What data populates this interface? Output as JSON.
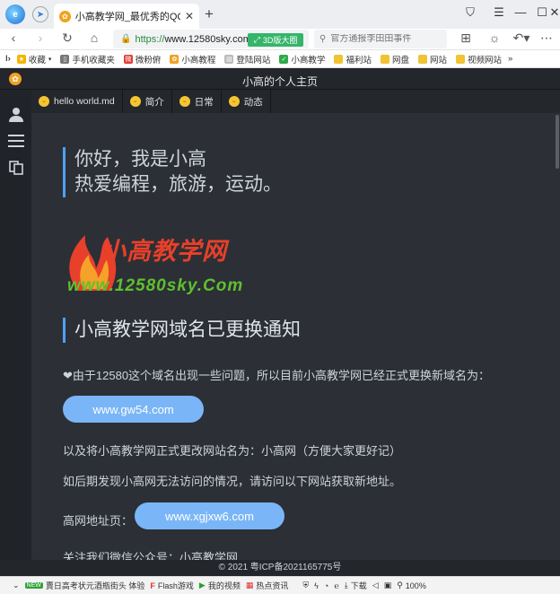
{
  "browser": {
    "tab_title": "小高教学网_最优秀的QQ技术网",
    "url_scheme": "https://",
    "url_host": "www.12580sky.com",
    "tag_label": "3D版大圈",
    "search_placeholder": "官方通报李田田事件",
    "bookmarks": [
      {
        "label": "收藏",
        "icon": "star-icon"
      },
      {
        "label": "手机收藏夹",
        "icon": "phone-icon"
      },
      {
        "label": "微粉俯",
        "icon": "weibo-icon"
      },
      {
        "label": "小高教程",
        "icon": "site-icon"
      },
      {
        "label": "登陆网站",
        "icon": "page-icon"
      },
      {
        "label": "小高教学",
        "icon": "check-icon"
      },
      {
        "label": "福利站",
        "icon": "folder-icon"
      },
      {
        "label": "网盘",
        "icon": "folder-icon"
      },
      {
        "label": "网站",
        "icon": "folder-icon"
      },
      {
        "label": "视频网站",
        "icon": "folder-icon"
      }
    ],
    "bookmarks_more": "»"
  },
  "site": {
    "title": "小高的个人主页",
    "tabs": [
      {
        "label": "hello world.md"
      },
      {
        "label": "简介"
      },
      {
        "label": "日常"
      },
      {
        "label": "动态"
      }
    ]
  },
  "content": {
    "hero_line1": "你好，我是小高",
    "hero_line2": "热爱编程，旅游，运动。",
    "logo_text": "小高教学网",
    "logo_url": "www.12580sky.Com",
    "heading": "小高教学网域名已更换通知",
    "notice": "❤由于12580这个域名出现一些问题，所以目前小高教学网已经正式更换新域名为：",
    "button1": "www.gw54.com",
    "rename": "以及将小高教学网正式更改网站名为：小高网（方便大家更好记）",
    "fallback": "如后期发现小高网无法访问的情况，请访问以下网站获取新地址。",
    "address_label": "高网地址页：",
    "button2": "www.xgjxw6.com",
    "follow": "关注我们微信公众号：小高教学网"
  },
  "footer": "© 2021 粤ICP备2021165775号",
  "statusbar": {
    "news_badge": "NEW",
    "news": "賣日高考状元酒瓶街头 体验",
    "flash": "Flash游戏",
    "video": "我的视频",
    "hot": "热点资讯",
    "download": "下载",
    "zoom": "100%"
  }
}
